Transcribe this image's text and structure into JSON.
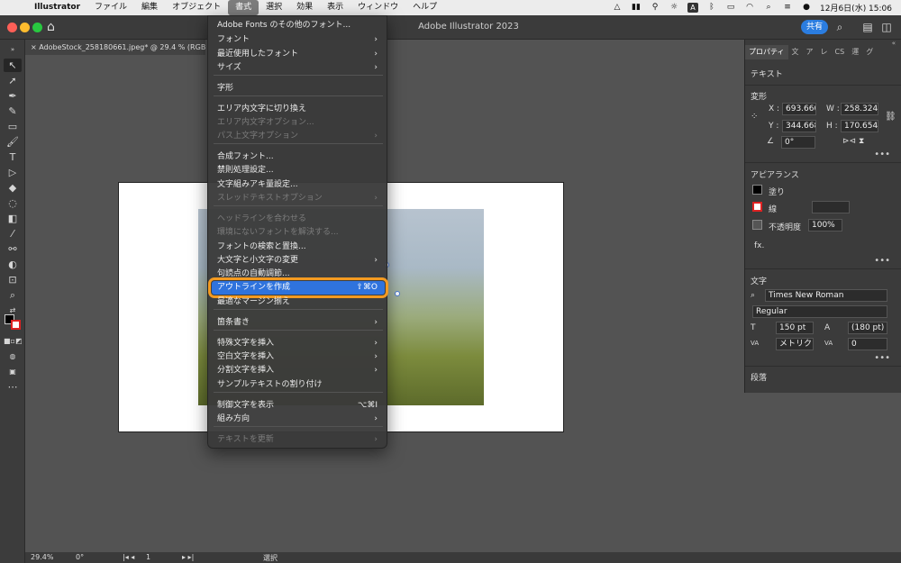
{
  "menubar": {
    "app": "Illustrator",
    "items": [
      "ファイル",
      "編集",
      "オブジェクト",
      "書式",
      "選択",
      "効果",
      "表示",
      "ウィンドウ",
      "ヘルプ"
    ],
    "active_index": 3,
    "status_a": "A",
    "date_time": "12月6日(水)  15:06"
  },
  "titlebar": {
    "title": "Adobe Illustrator 2023",
    "share": "共有"
  },
  "document": {
    "tab_label": "AdobeStock_258180661.jpeg* @ 29.4 % (RGB/プ",
    "close": "×"
  },
  "menu": {
    "items": [
      {
        "label": "Adobe Fonts のその他のフォント...",
        "submenu": false,
        "disabled": false
      },
      {
        "label": "フォント",
        "submenu": true,
        "disabled": false
      },
      {
        "label": "最近使用したフォント",
        "submenu": true,
        "disabled": false
      },
      {
        "label": "サイズ",
        "submenu": true,
        "disabled": false
      },
      {
        "label": "字形",
        "submenu": false,
        "disabled": false
      },
      {
        "label": "エリア内文字に切り換え",
        "submenu": false,
        "disabled": false
      },
      {
        "label": "エリア内文字オプション...",
        "submenu": false,
        "disabled": true
      },
      {
        "label": "パス上文字オプション",
        "submenu": true,
        "disabled": true
      },
      {
        "label": "合成フォント...",
        "submenu": false,
        "disabled": false
      },
      {
        "label": "禁則処理設定...",
        "submenu": false,
        "disabled": false
      },
      {
        "label": "文字組みアキ量設定...",
        "submenu": false,
        "disabled": false
      },
      {
        "label": "スレッドテキストオプション",
        "submenu": true,
        "disabled": true
      },
      {
        "label": "ヘッドラインを合わせる",
        "submenu": false,
        "disabled": true
      },
      {
        "label": "環境にないフォントを解決する...",
        "submenu": false,
        "disabled": true
      },
      {
        "label": "フォントの検索と置換...",
        "submenu": false,
        "disabled": false
      },
      {
        "label": "大文字と小文字の変更",
        "submenu": true,
        "disabled": false
      },
      {
        "label": "句読点の自動調節...",
        "submenu": false,
        "disabled": false
      },
      {
        "label": "アウトラインを作成",
        "submenu": false,
        "disabled": false,
        "shortcut": "⇧⌘O",
        "highlighted": true
      },
      {
        "label": "最適なマージン揃え",
        "submenu": false,
        "disabled": false
      },
      {
        "label": "箇条書き",
        "submenu": true,
        "disabled": false
      },
      {
        "label": "特殊文字を挿入",
        "submenu": true,
        "disabled": false
      },
      {
        "label": "空白文字を挿入",
        "submenu": true,
        "disabled": false
      },
      {
        "label": "分割文字を挿入",
        "submenu": true,
        "disabled": false
      },
      {
        "label": "サンプルテキストの割り付け",
        "submenu": false,
        "disabled": false
      },
      {
        "label": "制御文字を表示",
        "submenu": false,
        "disabled": false,
        "shortcut": "⌥⌘I"
      },
      {
        "label": "組み方向",
        "submenu": true,
        "disabled": false
      },
      {
        "label": "テキストを更新",
        "submenu": true,
        "disabled": true
      }
    ]
  },
  "panel": {
    "tabs": [
      "プロパティ",
      "文",
      "ア",
      "レ",
      "CS",
      "運",
      "グ"
    ],
    "text_heading": "テキスト",
    "transform_heading": "変形",
    "x_label": "X :",
    "x_value": "693.660",
    "w_label": "W :",
    "w_value": "258.324",
    "y_label": "Y :",
    "y_value": "344.668",
    "h_label": "H :",
    "h_value": "170.654",
    "angle_value": "0°",
    "appearance_heading": "アピアランス",
    "fill_label": "塗り",
    "stroke_label": "線",
    "opacity_label": "不透明度",
    "opacity_value": "100%",
    "fx_label": "fx.",
    "character_heading": "文字",
    "font_name": "Times New Roman",
    "font_style": "Regular",
    "font_size": "150 pt",
    "leading": "(180 pt)",
    "kerning": "メトリク",
    "tracking": "0",
    "paragraph_heading": "段落",
    "more": "•••"
  },
  "status": {
    "zoom": "29.4%",
    "rotation": "0°",
    "artboard": "1",
    "tool": "選択"
  }
}
